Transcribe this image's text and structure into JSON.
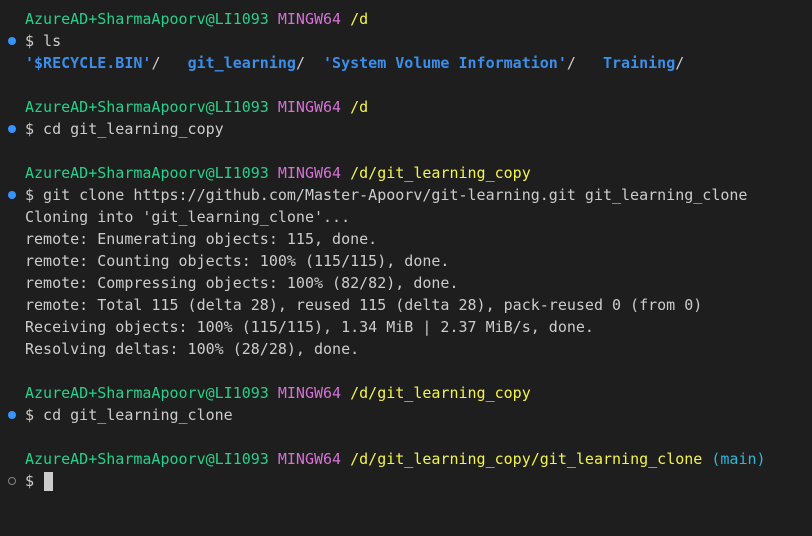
{
  "prompt": {
    "user_host": "AzureAD+SharmaApoorv@LI1093",
    "system": "MINGW64"
  },
  "blocks": [
    {
      "path": "/d",
      "command": "$ ls",
      "ls_output": {
        "entries": [
          "'$RECYCLE.BIN'",
          "git_learning",
          "'System Volume Information'",
          "Training"
        ],
        "separator": "/"
      }
    },
    {
      "path": "/d",
      "command": "$ cd git_learning_copy"
    },
    {
      "path": "/d/git_learning_copy",
      "command": "$ git clone https://github.com/Master-Apoorv/git-learning.git git_learning_clone",
      "output": [
        "Cloning into 'git_learning_clone'...",
        "remote: Enumerating objects: 115, done.",
        "remote: Counting objects: 100% (115/115), done.",
        "remote: Compressing objects: 100% (82/82), done.",
        "remote: Total 115 (delta 28), reused 115 (delta 28), pack-reused 0 (from 0)",
        "Receiving objects: 100% (115/115), 1.34 MiB | 2.37 MiB/s, done.",
        "Resolving deltas: 100% (28/28), done."
      ]
    },
    {
      "path": "/d/git_learning_copy",
      "command": "$ cd git_learning_clone"
    },
    {
      "path": "/d/git_learning_copy/git_learning_clone",
      "branch": "(main)",
      "command": "$ "
    }
  ],
  "colors": {
    "background": "#1e1e1e",
    "user_host": "#23d18b",
    "system": "#d670d6",
    "path": "#f5f543",
    "branch": "#29b8db",
    "directory": "#3b8eea",
    "text": "#cccccc",
    "success_dot": "#3794ff"
  }
}
